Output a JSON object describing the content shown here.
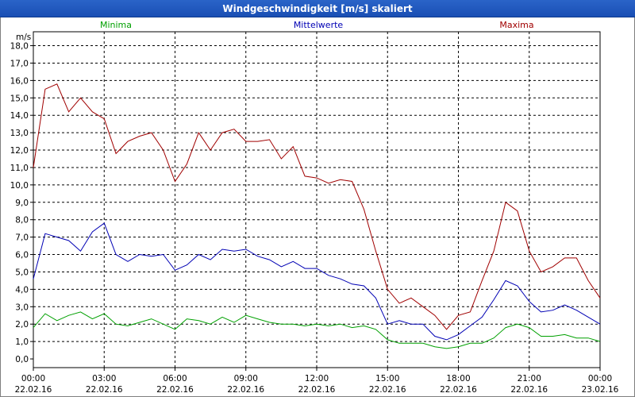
{
  "window": {
    "title": "Windgeschwindigkeit [m/s] skaliert"
  },
  "chart_data": {
    "type": "line",
    "title": "Windgeschwindigkeit [m/s] skaliert",
    "ylabel": "m/s",
    "xlabel": "",
    "ylim": [
      -0.5,
      18.8
    ],
    "yticks": [
      "0,0",
      "1,0",
      "2,0",
      "3,0",
      "4,0",
      "5,0",
      "6,0",
      "7,0",
      "8,0",
      "9,0",
      "10,0",
      "11,0",
      "12,0",
      "13,0",
      "14,0",
      "15,0",
      "16,0",
      "17,0",
      "18,0"
    ],
    "xtick_times": [
      "00:00",
      "03:00",
      "06:00",
      "09:00",
      "12:00",
      "15:00",
      "18:00",
      "21:00",
      "00:00"
    ],
    "xtick_dates": [
      "22.02.16",
      "22.02.16",
      "22.02.16",
      "22.02.16",
      "22.02.16",
      "22.02.16",
      "22.02.16",
      "22.02.16",
      "23.02.16"
    ],
    "x_unit": "hours since 22.02.16 00:00",
    "grid": true,
    "legend_position": "top",
    "series": [
      {
        "name": "Minima",
        "color": "#00a000",
        "x": [
          0,
          0.5,
          1,
          1.5,
          2,
          2.5,
          3,
          3.5,
          4,
          4.5,
          5,
          5.5,
          6,
          6.5,
          7,
          7.5,
          8,
          8.5,
          9,
          9.5,
          10,
          10.5,
          11,
          11.5,
          12,
          12.5,
          13,
          13.5,
          14,
          14.5,
          15,
          15.5,
          16,
          16.5,
          17,
          17.5,
          18,
          18.5,
          19,
          19.5,
          20,
          20.5,
          21,
          21.5,
          22,
          22.5,
          23,
          23.5,
          24
        ],
        "values": [
          1.8,
          2.6,
          2.2,
          2.5,
          2.7,
          2.3,
          2.6,
          2.0,
          1.9,
          2.1,
          2.3,
          2.0,
          1.7,
          2.3,
          2.2,
          2.0,
          2.4,
          2.1,
          2.5,
          2.3,
          2.1,
          2.0,
          2.0,
          1.9,
          2.0,
          1.9,
          2.0,
          1.8,
          1.9,
          1.7,
          1.1,
          0.9,
          0.9,
          0.9,
          0.7,
          0.6,
          0.7,
          0.9,
          0.9,
          1.2,
          1.8,
          2.0,
          1.8,
          1.3,
          1.3,
          1.4,
          1.2,
          1.2,
          1.0
        ]
      },
      {
        "name": "Mittelwerte",
        "color": "#0000b4",
        "x": [
          0,
          0.5,
          1,
          1.5,
          2,
          2.5,
          3,
          3.5,
          4,
          4.5,
          5,
          5.5,
          6,
          6.5,
          7,
          7.5,
          8,
          8.5,
          9,
          9.5,
          10,
          10.5,
          11,
          11.5,
          12,
          12.5,
          13,
          13.5,
          14,
          14.5,
          15,
          15.5,
          16,
          16.5,
          17,
          17.5,
          18,
          18.5,
          19,
          19.5,
          20,
          20.5,
          21,
          21.5,
          22,
          22.5,
          23,
          23.5,
          24
        ],
        "values": [
          4.6,
          7.2,
          7.0,
          6.8,
          6.2,
          7.3,
          7.8,
          6.0,
          5.6,
          6.0,
          5.9,
          6.0,
          5.1,
          5.4,
          6.0,
          5.7,
          6.3,
          6.2,
          6.3,
          5.9,
          5.7,
          5.3,
          5.6,
          5.2,
          5.2,
          4.8,
          4.6,
          4.3,
          4.2,
          3.5,
          2.0,
          2.2,
          2.0,
          2.0,
          1.3,
          1.1,
          1.4,
          1.9,
          2.4,
          3.4,
          4.5,
          4.2,
          3.3,
          2.7,
          2.8,
          3.1,
          2.8,
          2.4,
          2.0
        ]
      },
      {
        "name": "Maxima",
        "color": "#a00000",
        "x": [
          0,
          0.5,
          1,
          1.5,
          2,
          2.5,
          3,
          3.5,
          4,
          4.5,
          5,
          5.5,
          6,
          6.5,
          7,
          7.5,
          8,
          8.5,
          9,
          9.5,
          10,
          10.5,
          11,
          11.5,
          12,
          12.5,
          13,
          13.5,
          14,
          14.5,
          15,
          15.5,
          16,
          16.5,
          17,
          17.5,
          18,
          18.5,
          19,
          19.5,
          20,
          20.5,
          21,
          21.5,
          22,
          22.5,
          23,
          23.5,
          24
        ],
        "values": [
          11.0,
          15.5,
          15.8,
          14.2,
          15.0,
          14.2,
          13.8,
          11.8,
          12.5,
          12.8,
          13.0,
          12.0,
          10.2,
          11.2,
          13.0,
          12.0,
          13.0,
          13.2,
          12.5,
          12.5,
          12.6,
          11.5,
          12.2,
          10.5,
          10.4,
          10.1,
          10.3,
          10.2,
          8.6,
          6.2,
          4.0,
          3.2,
          3.5,
          3.0,
          2.5,
          1.7,
          2.5,
          2.7,
          4.5,
          6.2,
          9.0,
          8.5,
          6.2,
          5.0,
          5.3,
          5.8,
          5.8,
          4.5,
          3.5
        ]
      }
    ]
  }
}
